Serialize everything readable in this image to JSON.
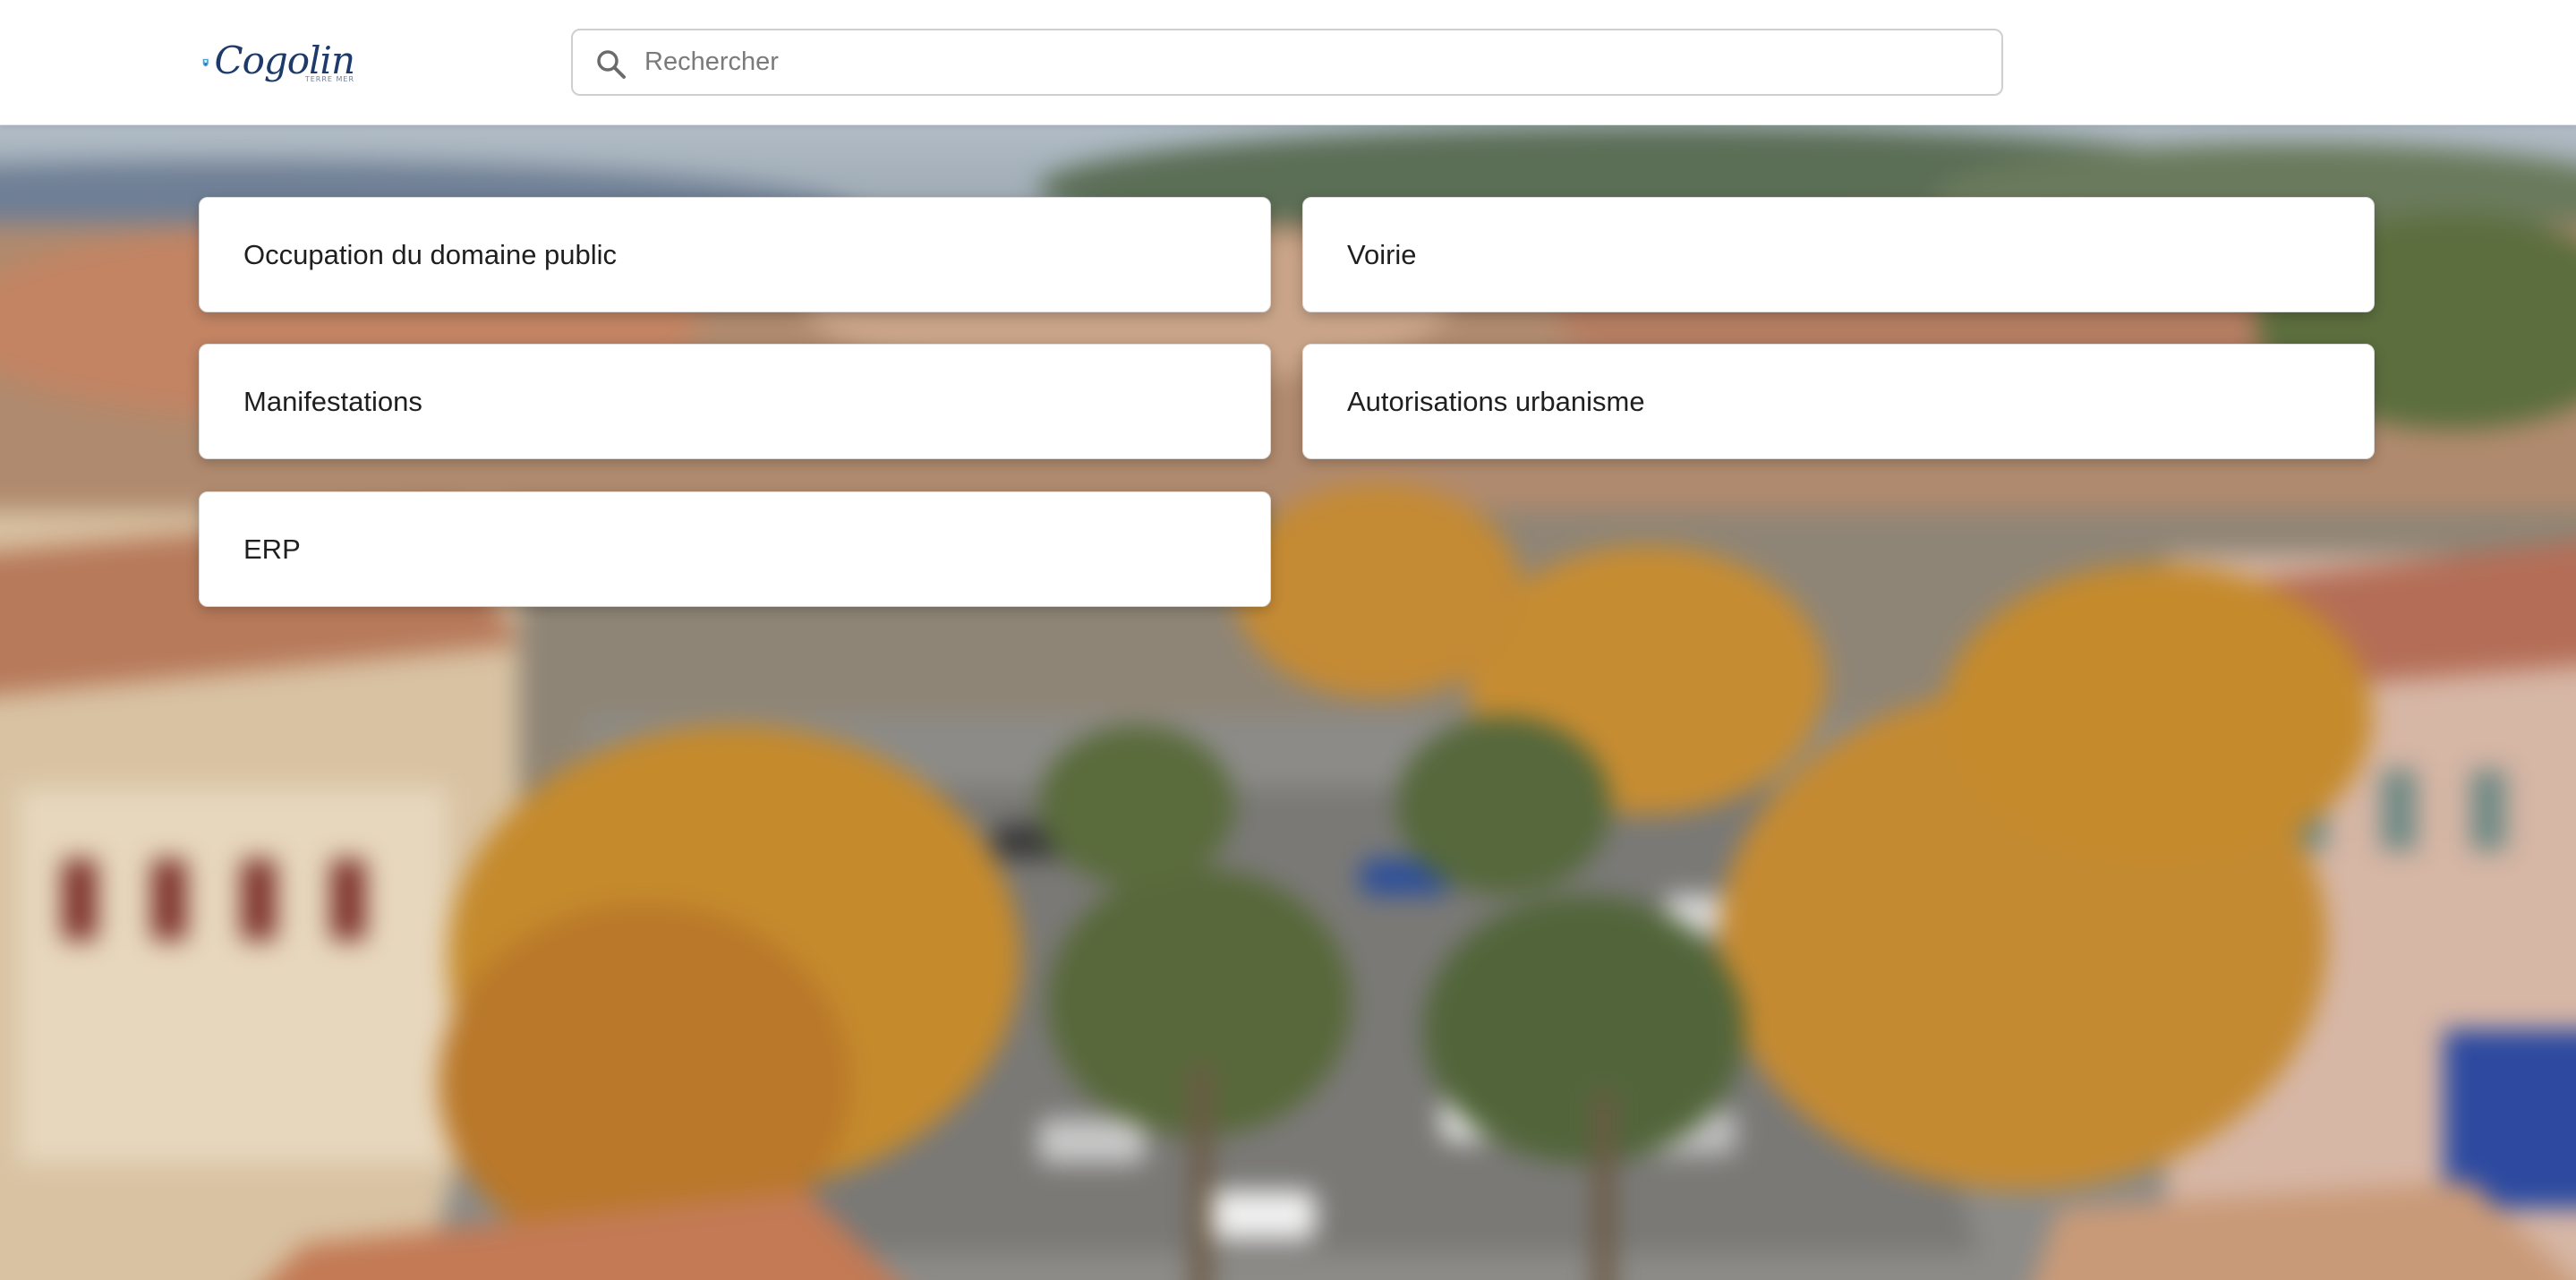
{
  "header": {
    "logo": {
      "brand": "Cogolin",
      "tagline": "TERRE MER"
    },
    "search": {
      "placeholder": "Rechercher",
      "value": ""
    }
  },
  "categories": [
    {
      "label": "Occupation du domaine public"
    },
    {
      "label": "Voirie"
    },
    {
      "label": "Manifestations"
    },
    {
      "label": "Autorisations urbanisme"
    },
    {
      "label": "ERP"
    }
  ],
  "colors": {
    "brand": "#1d3a6b",
    "accent": "#4aa3d8"
  }
}
